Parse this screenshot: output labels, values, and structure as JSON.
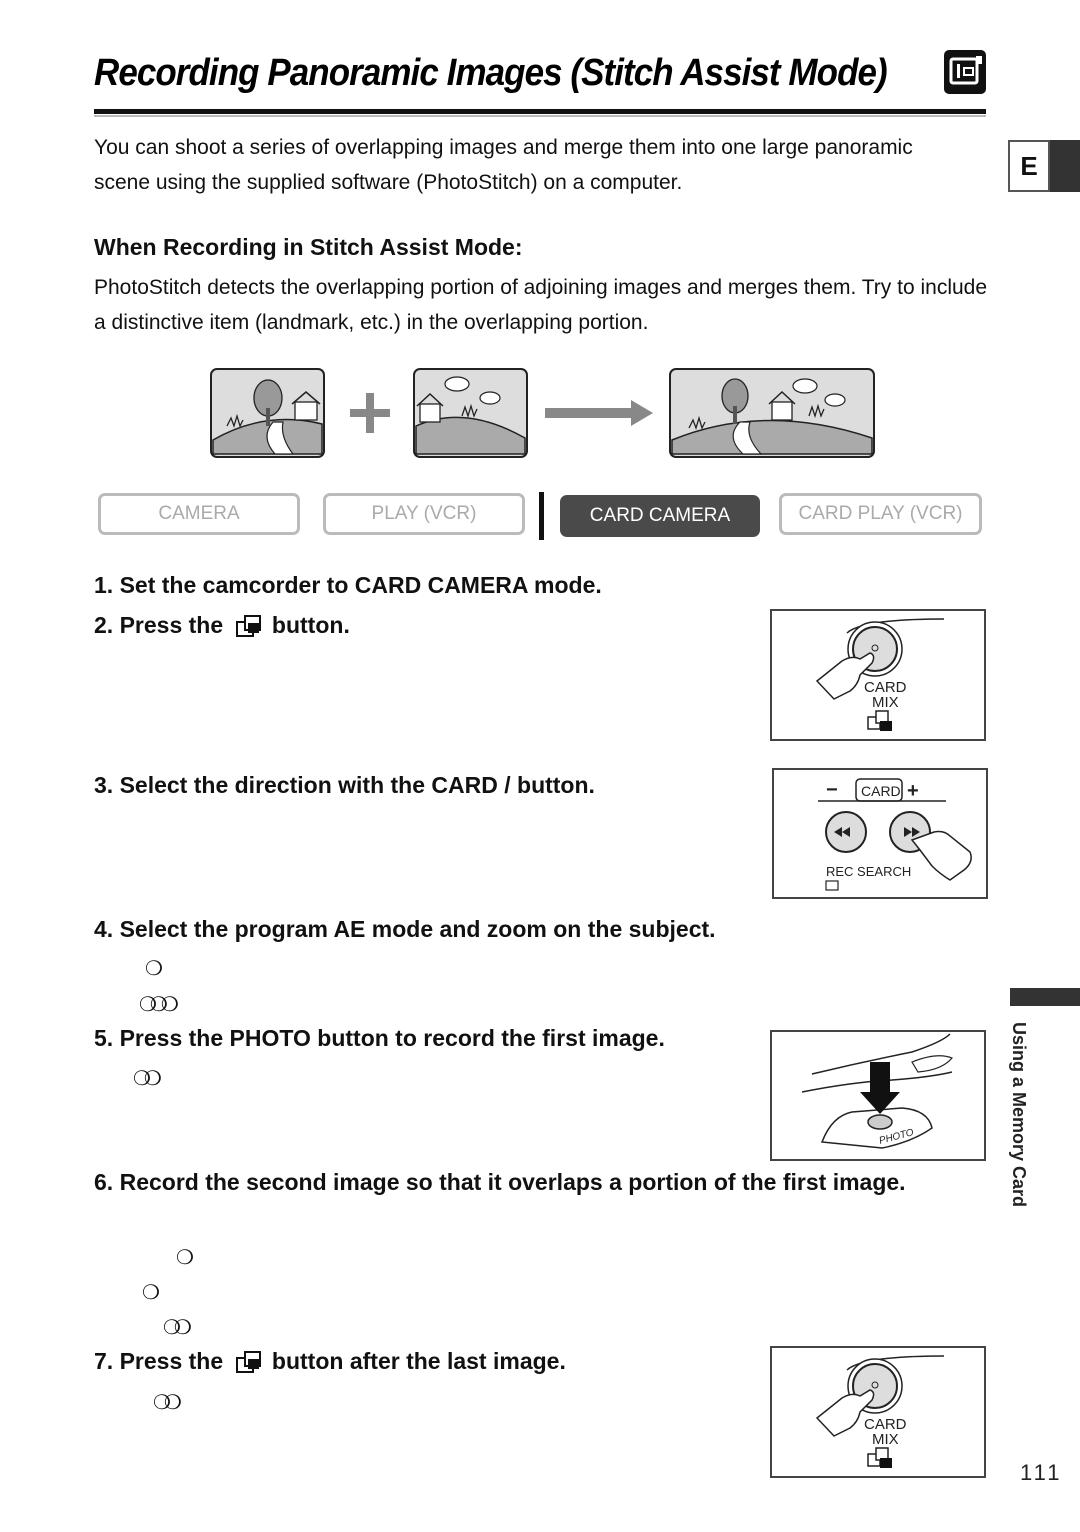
{
  "header": {
    "title": "Recording Panoramic Images (Stitch Assist Mode)",
    "title_icon": "card-camera-mode-icon"
  },
  "intro": "You can shoot a series of overlapping images and merge them into one large panoramic scene using the supplied software (PhotoStitch) on a computer.",
  "language_tab": "E",
  "section": {
    "heading": "When Recording in Stitch Assist Mode:",
    "text": "PhotoStitch detects the overlapping portion of adjoining images and merges them. Try to include a distinctive item (landmark, etc.) in the overlapping portion."
  },
  "illustration": {
    "plus_symbol": "+",
    "arrow": "right-arrow"
  },
  "modes": [
    {
      "label": "CAMERA",
      "active": false
    },
    {
      "label": "PLAY (VCR)",
      "active": false
    },
    {
      "label": "CARD CAMERA",
      "active": true
    },
    {
      "label": "CARD PLAY (VCR)",
      "active": false
    }
  ],
  "steps": [
    {
      "number": "1.",
      "text": "Set the camcorder to CARD CAMERA mode."
    },
    {
      "number": "2.",
      "text_before": "Press the",
      "text_after": "button."
    },
    {
      "number": "3.",
      "text": "Select the direction with the CARD   / button."
    },
    {
      "number": "4.",
      "text": "Select the program AE mode and zoom on the subject."
    },
    {
      "number": "5.",
      "text": "Press the PHOTO button to record the first image."
    },
    {
      "number": "6.",
      "text": "Record the second image so that it overlaps a portion of the first image."
    },
    {
      "number": "7.",
      "text_before": "Press the",
      "text_after": "button after the last image."
    }
  ],
  "markers": {
    "m4a": "❍",
    "m4b": "❍❍❍",
    "m5a": "❍❍",
    "m6a": "❍",
    "m6b": "❍",
    "m6c": "❍❍",
    "m7a": "❍❍"
  },
  "panels": {
    "card_mix": {
      "label_top": "CARD",
      "label_bottom": "MIX"
    },
    "card_search": {
      "label_card": "CARD",
      "minus": "−",
      "plus": "+",
      "rec_search": "REC SEARCH"
    },
    "photo": {
      "label": "PHOTO"
    }
  },
  "sidebar": {
    "section_label": "Using a Memory Card"
  },
  "page_number": "111"
}
